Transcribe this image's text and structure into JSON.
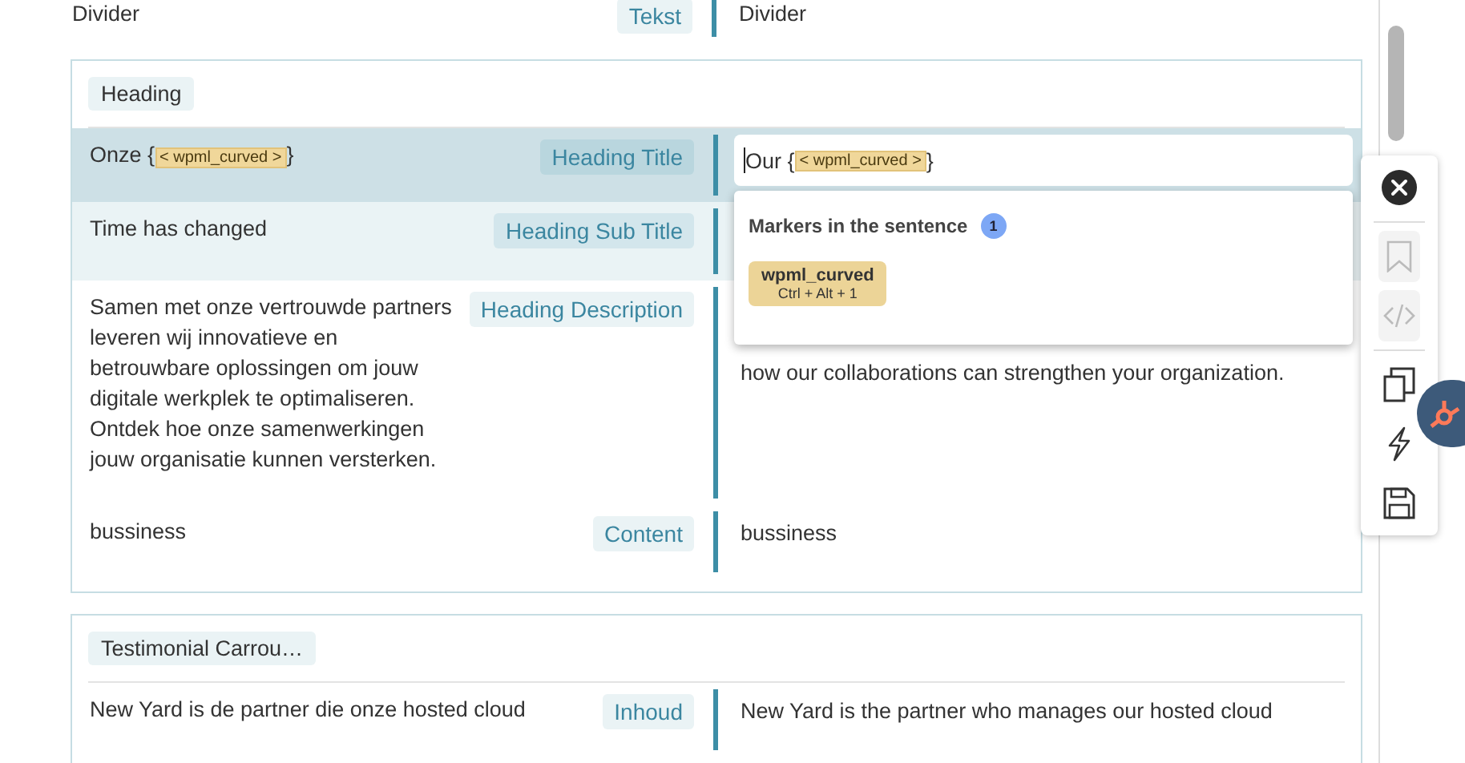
{
  "top_row": {
    "source": "Divider",
    "tag": "Tekst",
    "translation": "Divider"
  },
  "sections": [
    {
      "title": "Heading",
      "rows": [
        {
          "selected": true,
          "highlighted": false,
          "source": [
            {
              "kind": "text",
              "text": "Onze {"
            },
            {
              "kind": "marker",
              "text": "< wpml_curved >"
            },
            {
              "kind": "text",
              "text": "}"
            }
          ],
          "tag": "Heading Title",
          "editor": {
            "parts": [
              {
                "kind": "text",
                "text": "Our {"
              },
              {
                "kind": "marker",
                "text": "< wpml_curved >"
              },
              {
                "kind": "text",
                "text": "}"
              }
            ]
          }
        },
        {
          "selected": false,
          "highlighted": true,
          "source": [
            {
              "kind": "text",
              "text": "Time has changed"
            }
          ],
          "tag": "Heading Sub Title"
        },
        {
          "selected": false,
          "highlighted": false,
          "source": [
            {
              "kind": "text",
              "text": "Samen met onze vertrouwde partners leveren wij innovatieve en betrouwbare oplossingen om jouw digitale werkplek te optimaliseren. Ontdek hoe onze samenwerkingen jouw organisatie kunnen versterken."
            }
          ],
          "tag": "Heading Description",
          "translation": "how our collaborations can strengthen your organization."
        },
        {
          "selected": false,
          "highlighted": false,
          "source": [
            {
              "kind": "text",
              "text": "bussiness"
            }
          ],
          "tag": "Content",
          "translation": "bussiness"
        }
      ]
    },
    {
      "title": "Testimonial Carrou…",
      "rows": [
        {
          "selected": false,
          "highlighted": false,
          "source": [
            {
              "kind": "text",
              "text": "New Yard is de partner die onze hosted cloud"
            }
          ],
          "tag": "Inhoud",
          "translation": "New Yard is the partner who manages our hosted cloud"
        }
      ]
    }
  ],
  "markers_popup": {
    "title": "Markers in the sentence",
    "count": "1",
    "markers": [
      {
        "name": "wpml_curved",
        "shortcut": "Ctrl + Alt + 1"
      }
    ]
  },
  "toolbar": [
    {
      "kind": "close",
      "disabled": false
    },
    {
      "kind": "bookmark",
      "disabled": true
    },
    {
      "kind": "code",
      "disabled": true
    },
    {
      "kind": "copy",
      "disabled": false
    },
    {
      "kind": "bolt",
      "disabled": false
    },
    {
      "kind": "save",
      "disabled": false
    }
  ]
}
